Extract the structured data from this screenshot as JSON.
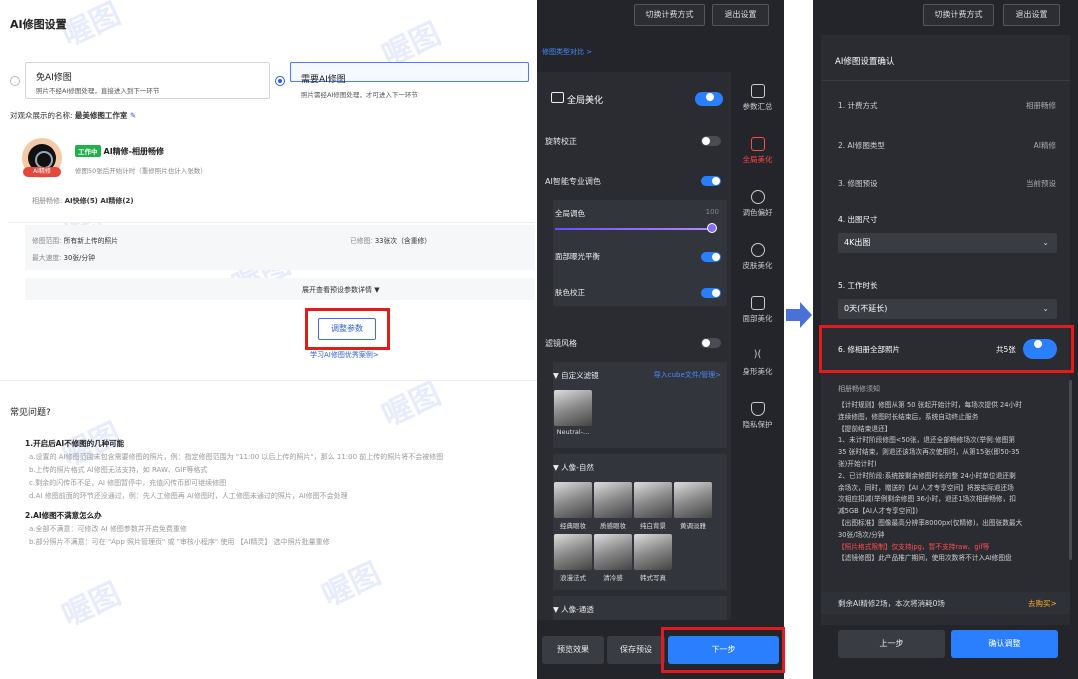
{
  "left": {
    "title": "AI修图设置",
    "option_no": {
      "title": "免AI修图",
      "desc": "照片不经AI修图处理，直接进入到下一环节"
    },
    "option_yes": {
      "title": "需要AI修图",
      "desc": "照片需经AI修图处理，才可进入下一环节"
    },
    "display_name_label": "对观众展示的名称:",
    "display_name_value": "最美修图工作室",
    "avatar_tag": "AI精修",
    "badge": "工作中",
    "mode_title": "AI精修-相册畅修",
    "mode_desc": "修图50张后开始计时（重修照片也计入张数）",
    "mode_row_label": "相册畅修:",
    "mode_row_value": "AI快修(5) AI精修(2)",
    "range_label": "修图范围:",
    "range_value": "所有新上传的照片",
    "done_label": "已修图:",
    "done_value": "33张次（含重修）",
    "speed_label": "最大速度:",
    "speed_value": "30张/分钟",
    "expand_text": "展开查看预设参数详情 ▼",
    "adjust_button": "调整参数",
    "learn_link": "学习AI修图优秀案例>",
    "faq_title": "常见问题?",
    "faq1_title": "1.开启后AI不修图的几种可能",
    "faq1_items": [
      "a.设置的 AI修图范围未包含需要修图的照片，例：指定修图范围为 \"11:00 以后上传的照片\"，那么 11:00 前上传的照片将不会被修图",
      "b.上传的照片格式 AI修图无法支持，如 RAW、GIF等格式",
      "c.剩余的闪传币不足，AI 修图暂停中，充值闪传币即可继续修图",
      "d.AI 修图前面的环节还没通过，例：先人工修图再 AI修图时，人工修图未通过的照片，AI修图不会处理"
    ],
    "faq2_title": "2.AI修图不满意怎么办",
    "faq2_items": [
      "a.全部不满意：可修改 AI 修图参数并开启免费重修",
      "b.部分照片不满意：可在 \"App 照片管理页\" 或 \"审核小程序\" 使用 【AI精灵】 选中照片批量重修"
    ],
    "watermark": "喔图"
  },
  "mid": {
    "btn_switch": "切换计费方式",
    "btn_exit": "退出设置",
    "compare_link": "修图类型对比 >",
    "global_title": "全局美化",
    "rows": {
      "rotate": "旋转校正",
      "ai_color": "AI智能专业调色",
      "global_tone": "全局调色",
      "global_tone_value": "100",
      "face_exposure": "面部曝光平衡",
      "skin_correct": "肤色校正",
      "filter_style": "滤镜风格"
    },
    "custom_filter": "▼ 自定义滤镜",
    "import_cube": "导入cube文件/管理>",
    "neutral": "Neutral-...",
    "portrait_nature": "▼ 人像-自然",
    "thumbs_row1": [
      "经典眼妆",
      "质感眼妆",
      "纯白背景",
      "黄调淡雅"
    ],
    "thumbs_row2": [
      "浪漫法式",
      "清冷感",
      "韩式写真"
    ],
    "portrait_common": "▼ 人像-通透",
    "nav": [
      "参数汇总",
      "全局美化",
      "调色偏好",
      "皮肤美化",
      "面部美化",
      "身形美化",
      "隐私保护"
    ],
    "btn_preview": "预览效果",
    "btn_save": "保存预设",
    "btn_next": "下一步"
  },
  "right": {
    "btn_switch": "切换计费方式",
    "btn_exit": "退出设置",
    "confirm_title": "AI修图设置确认",
    "r1_label": "1. 计费方式",
    "r1_value": "相册畅修",
    "r2_label": "2. AI修图类型",
    "r2_value": "AI精修",
    "r3_label": "3. 修图预设",
    "r3_value": "当前预设",
    "r4_label": "4. 出图尺寸",
    "r4_select": "4K出图",
    "r5_label": "5. 工作时长",
    "r5_select": "0天(不延长)",
    "r6_label": "6. 修相册全部照片",
    "r6_value": "共5张",
    "notice_title": "相册畅修须知",
    "notice_lines": [
      "【计时规则】修图从第 50 张起开始计时，每场次提供 24小时",
      "连续修图，修图时长结束后，系统自动终止服务",
      "【提前结束退还】",
      "1、未计时阶段修图<50张，退还全部畅修场次(举例:修图第",
      "35 张时结束，则退还该场次再次使用时，从第15张(即50-35",
      "张)开始计时)",
      "2、已计时阶段:系统按剩余修图时长的整 24小时单位退还剩",
      "余场次，同时，赠送的【AI 人才专享空间】将按实际退还场",
      "次相应扣减(举例剩余修图 36小时，退还1场次相册畅修，扣",
      "减5GB【AI人才专享空间】)",
      "【出图标准】图像最高分辨率8000px(仅精修)，出图张数最大",
      "30张/场次/分钟"
    ],
    "notice_red": "【照片格式限制】仅支持jpg，暂不支持raw、gif等",
    "notice_last": "【滤镜修图】此产品推广期间，使用次数将不计入AI修图盘",
    "remain_text": "剩余AI精修2场，本次将消耗0场",
    "buy_link": "去购买>",
    "btn_prev": "上一步",
    "btn_confirm": "确认调整"
  },
  "colors": {
    "accent": "#2a7fff",
    "highlight": "#e31b1b",
    "arrow": "#4a72d6"
  }
}
